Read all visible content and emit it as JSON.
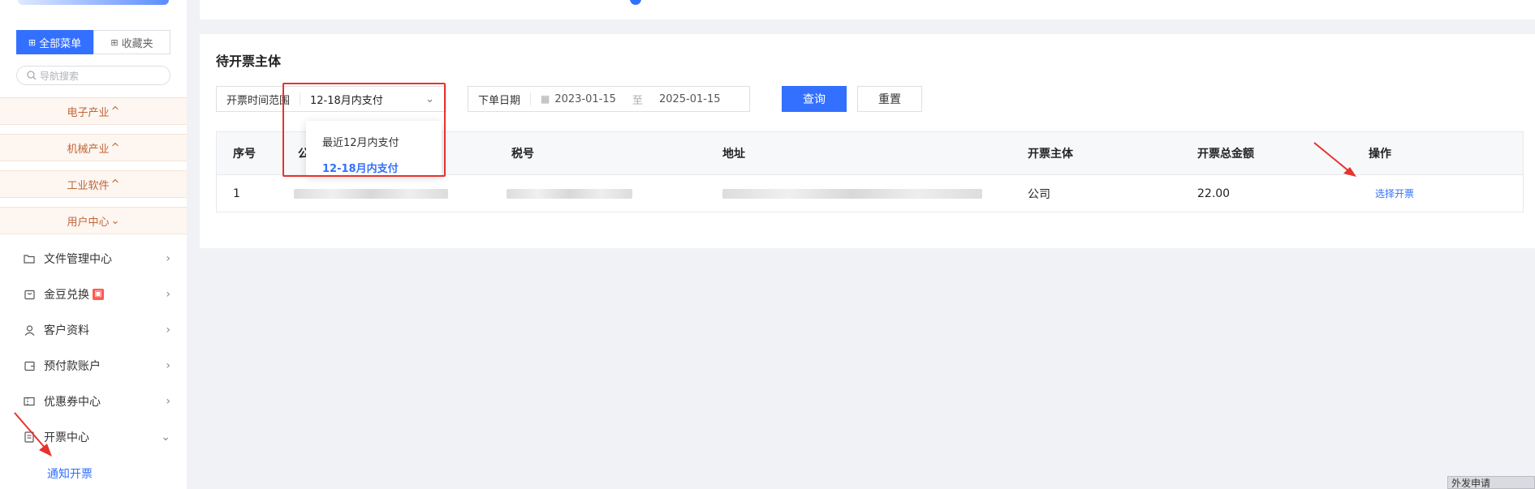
{
  "sidebar": {
    "tabs": {
      "all_menu": "全部菜单",
      "favorites": "收藏夹"
    },
    "search_placeholder": "导航搜索",
    "categories": [
      "电子产业",
      "机械产业",
      "工业软件",
      "用户中心"
    ],
    "items": [
      {
        "label": "文件管理中心",
        "icon": "folder-icon"
      },
      {
        "label": "金豆兑换",
        "icon": "bag-icon",
        "badge_icon": "gift-icon"
      },
      {
        "label": "客户资料",
        "icon": "user-icon"
      },
      {
        "label": "预付款账户",
        "icon": "wallet-icon"
      },
      {
        "label": "优惠券中心",
        "icon": "coupon-icon"
      },
      {
        "label": "开票中心",
        "icon": "invoice-icon"
      }
    ],
    "sub_item": "通知开票"
  },
  "panel": {
    "title": "待开票主体",
    "filters": {
      "range_label": "开票时间范围",
      "range_value": "12-18月内支付",
      "order_date_label": "下单日期",
      "date_start": "2023-01-15",
      "date_sep": "至",
      "date_end": "2025-01-15"
    },
    "buttons": {
      "query": "查询",
      "reset": "重置"
    },
    "dropdown": {
      "options": [
        "最近12月内支付",
        "12-18月内支付"
      ],
      "selected": "12-18月内支付"
    },
    "table": {
      "headers": {
        "index": "序号",
        "company_partial": "公",
        "tax_no": "税号",
        "address": "地址",
        "entity": "开票主体",
        "total": "开票总金额",
        "action": "操作"
      },
      "rows": [
        {
          "index": "1",
          "entity": "公司",
          "total": "22.00",
          "action": "选择开票"
        }
      ]
    }
  },
  "corner_button": "外发申请",
  "colors": {
    "accent": "#3370ff",
    "highlight": "#e8322d",
    "category_text": "#c0653a"
  }
}
